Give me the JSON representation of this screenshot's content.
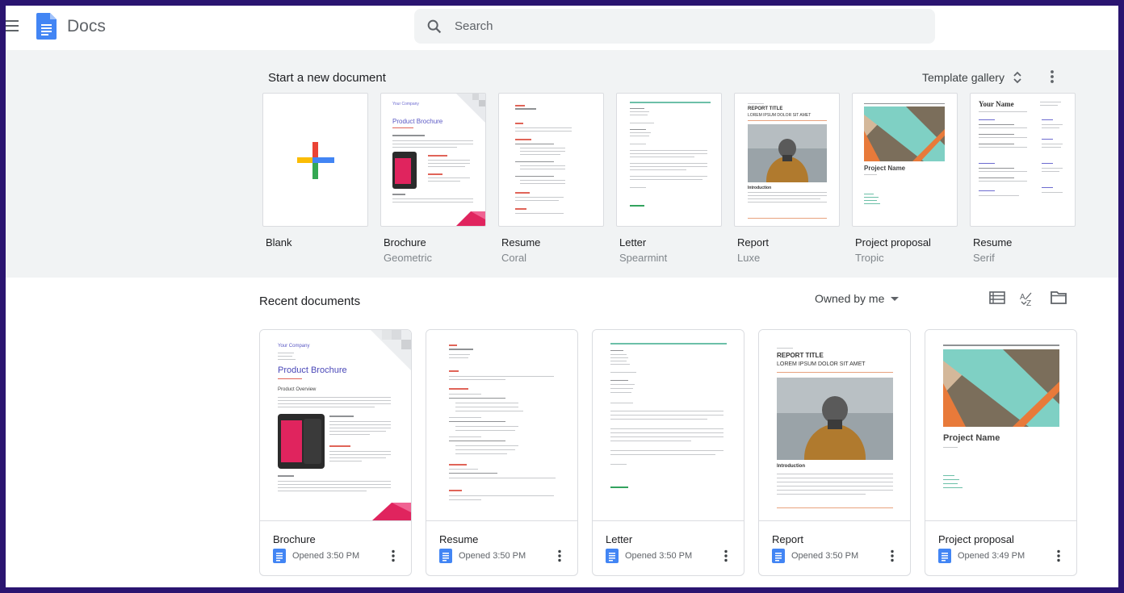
{
  "header": {
    "app_title": "Docs",
    "search_placeholder": "Search"
  },
  "templates": {
    "heading": "Start a new document",
    "gallery_label": "Template gallery",
    "items": [
      {
        "name": "Blank",
        "sub": ""
      },
      {
        "name": "Brochure",
        "sub": "Geometric"
      },
      {
        "name": "Resume",
        "sub": "Coral"
      },
      {
        "name": "Letter",
        "sub": "Spearmint"
      },
      {
        "name": "Report",
        "sub": "Luxe"
      },
      {
        "name": "Project proposal",
        "sub": "Tropic"
      },
      {
        "name": "Resume",
        "sub": "Serif"
      }
    ],
    "thumb_text": {
      "your_company": "Your Company",
      "product_brochure": "Product Brochure",
      "report_title": "REPORT TITLE",
      "report_sub": "LOREM IPSUM DOLOR SIT AMET",
      "introduction": "Introduction",
      "project_name": "Project Name",
      "your_name": "Your Name"
    }
  },
  "recent": {
    "heading": "Recent documents",
    "owner_filter": "Owned by me",
    "docs": [
      {
        "title": "Brochure",
        "meta": "Opened 3:50 PM"
      },
      {
        "title": "Resume",
        "meta": "Opened 3:50 PM"
      },
      {
        "title": "Letter",
        "meta": "Opened 3:50 PM"
      },
      {
        "title": "Report",
        "meta": "Opened 3:50 PM"
      },
      {
        "title": "Project proposal",
        "meta": "Opened 3:49 PM"
      }
    ],
    "thumb_text": {
      "your_company": "Your Company",
      "product_brochure": "Product Brochure",
      "product_overview": "Product Overview",
      "report_title": "REPORT TITLE",
      "report_sub": "LOREM IPSUM DOLOR SIT AMET",
      "introduction": "Introduction",
      "project_name": "Project Name"
    }
  },
  "colors": {
    "docs_blue": "#4285f4",
    "plus_red": "#ea4335",
    "plus_yellow": "#fbbc04",
    "plus_green": "#34a853",
    "plus_blue": "#4285f4",
    "brochure_pink": "#e0245e"
  },
  "icons": [
    "menu-icon",
    "docs-logo-icon",
    "search-icon",
    "more-vert-icon",
    "sort-updown-icon",
    "list-view-icon",
    "sort-az-icon",
    "folder-icon",
    "doc-file-icon"
  ]
}
